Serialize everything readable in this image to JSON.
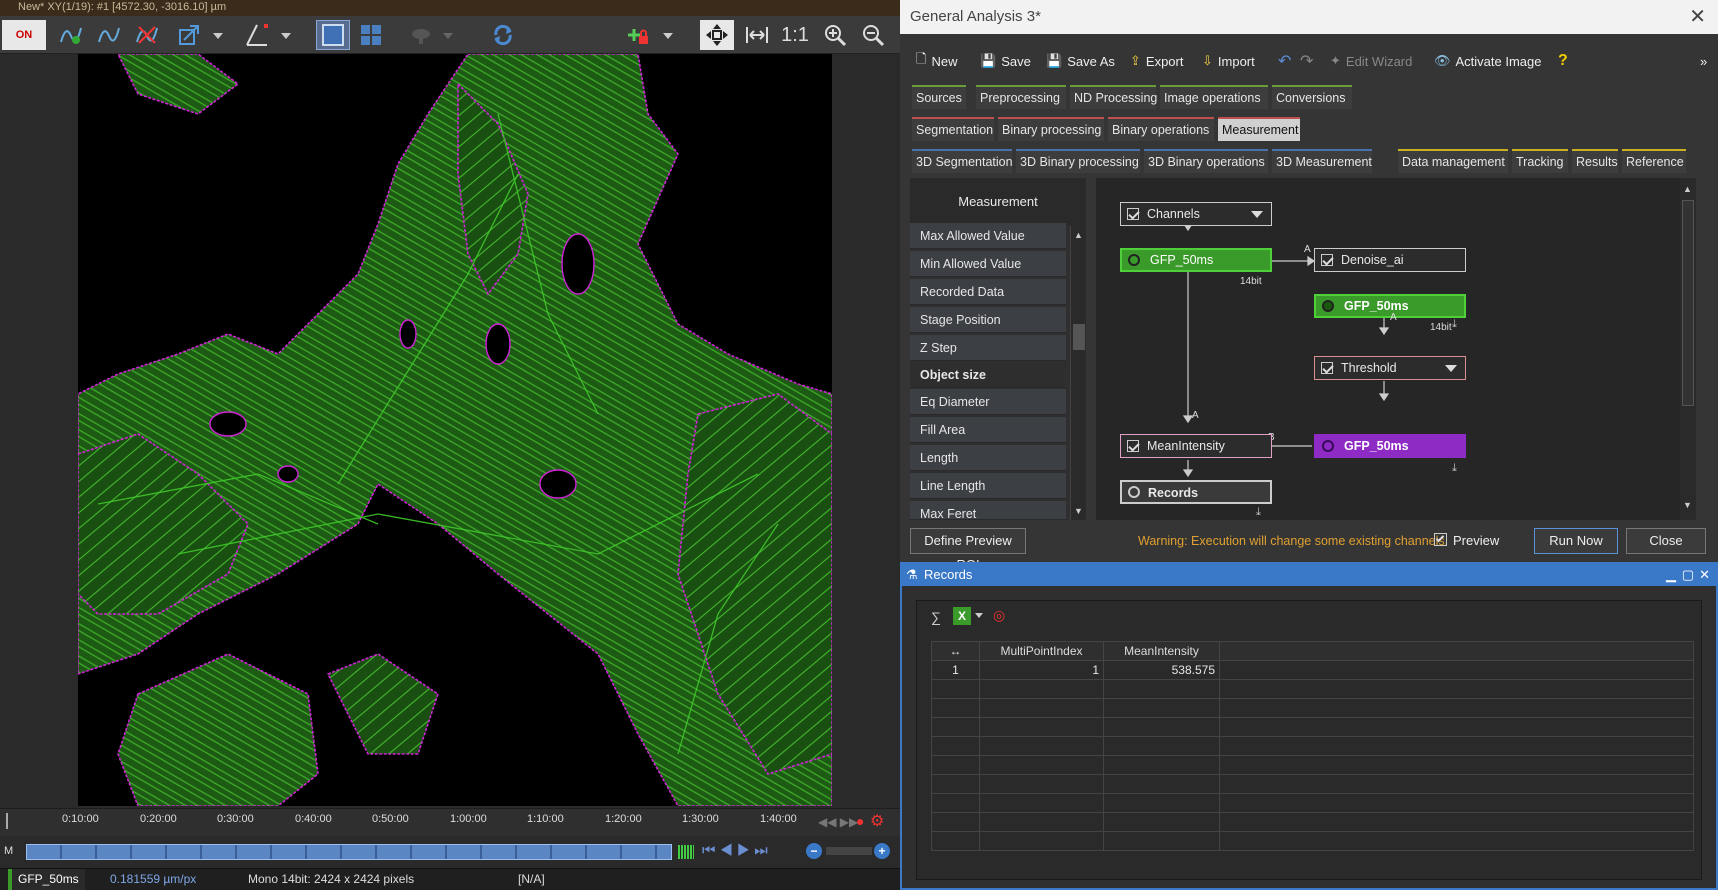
{
  "viewer": {
    "title": "New*   XY(1/19): #1 [4572.30, -3016.10] µm",
    "on_label": "ON",
    "one_to_one": "1:1",
    "timeline_ticks": [
      "0:10:00",
      "0:20:00",
      "0:30:00",
      "0:40:00",
      "0:50:00",
      "1:00:00",
      "1:10:00",
      "1:20:00",
      "1:30:00",
      "1:40:00"
    ],
    "m_label": "M",
    "status": {
      "channel": "GFP_50ms",
      "pixel_size": "0.181559 µm/px",
      "format": "Mono 14bit: 2424 x 2424 pixels",
      "extra": "[N/A]"
    }
  },
  "ga": {
    "title": "General Analysis 3*",
    "toolbar": {
      "new": "New",
      "save": "Save",
      "save_as": "Save As",
      "export": "Export",
      "import": "Import",
      "edit_wizard": "Edit Wizard",
      "activate_image": "Activate Image"
    },
    "tabs_row1": [
      "Sources",
      "Preprocessing",
      "ND Processing",
      "Image operations",
      "Conversions"
    ],
    "tabs_row2": [
      "Segmentation",
      "Binary processing",
      "Binary operations",
      "Measurement"
    ],
    "tabs_row3": [
      "3D Segmentation",
      "3D Binary processing",
      "3D Binary operations",
      "3D Measurement",
      "Data management",
      "Tracking",
      "Results",
      "Reference"
    ],
    "measurement_panel": {
      "title": "Measurement",
      "items": [
        "Max Allowed Value",
        "Min Allowed Value",
        "Recorded Data",
        "Stage Position",
        "Z Step"
      ],
      "group": "Object size",
      "group_items": [
        "Eq Diameter",
        "Fill Area",
        "Length",
        "Line Length",
        "Max Feret"
      ]
    },
    "graph": {
      "channels": "Channels",
      "gfp1": "GFP_50ms",
      "bit1": "14bit",
      "denoise": "Denoise_ai",
      "gfp2": "GFP_50ms",
      "bit2": "14bit",
      "threshold": "Threshold",
      "gfp3": "GFP_50ms",
      "meanintensity": "MeanIntensity",
      "records": "Records",
      "port_a": "A",
      "port_b": "B"
    },
    "bottom": {
      "define_roi": "Define Preview ROI",
      "warning": "Warning: Execution will change some existing channels.",
      "preview": "Preview",
      "run_now": "Run Now",
      "close": "Close"
    }
  },
  "records": {
    "title": "Records",
    "columns": [
      "MultiPointIndex",
      "MeanIntensity"
    ],
    "rows": [
      {
        "index": "1",
        "multipoint": "1",
        "mean": "538.575"
      }
    ]
  },
  "colors": {
    "channel_green": "#3a9a2a",
    "binary_purple": "#8e2bc4",
    "accent_blue": "#3a78c8",
    "warning": "#e0a030"
  }
}
